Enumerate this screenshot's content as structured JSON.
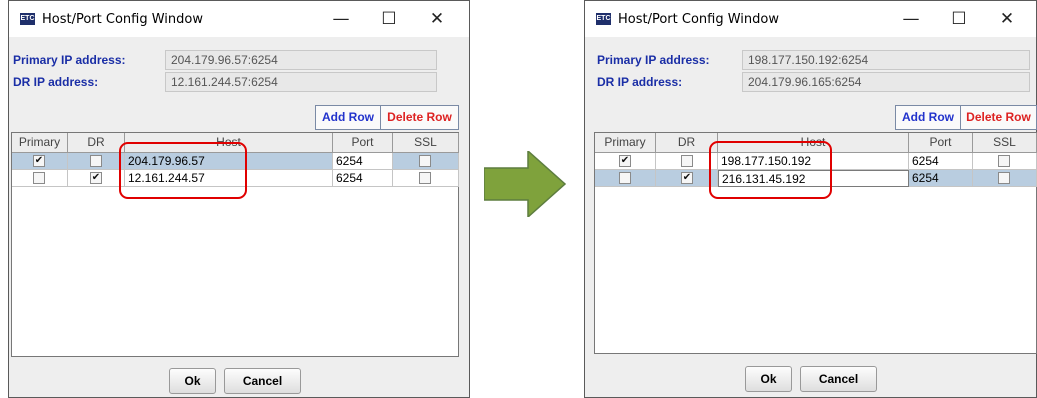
{
  "windows": [
    {
      "title": "Host/Port Config Window",
      "icon_text": "ETC",
      "controls": {
        "minimize": "—",
        "maximize": "☐",
        "close": "✕"
      },
      "primary_label": "Primary IP address:",
      "primary_value": "204.179.96.57:6254",
      "dr_label": "DR IP address:",
      "dr_value": "12.161.244.57:6254",
      "add_row": "Add Row",
      "delete_row": "Delete Row",
      "columns": [
        "Primary",
        "DR",
        "Host",
        "Port",
        "SSL"
      ],
      "rows": [
        {
          "primary": true,
          "dr": false,
          "host": "204.179.96.57",
          "port": "6254",
          "ssl": false,
          "selected": true
        },
        {
          "primary": false,
          "dr": true,
          "host": "12.161.244.57",
          "port": "6254",
          "ssl": false,
          "selected": false
        }
      ],
      "ok": "Ok",
      "cancel": "Cancel"
    },
    {
      "title": "Host/Port Config Window",
      "icon_text": "ETC",
      "controls": {
        "minimize": "—",
        "maximize": "☐",
        "close": "✕"
      },
      "primary_label": "Primary IP address:",
      "primary_value": "198.177.150.192:6254",
      "dr_label": "DR IP address:",
      "dr_value": "204.179.96.165:6254",
      "add_row": "Add Row",
      "delete_row": "Delete Row",
      "columns": [
        "Primary",
        "DR",
        "Host",
        "Port",
        "SSL"
      ],
      "rows": [
        {
          "primary": true,
          "dr": false,
          "host": "198.177.150.192",
          "port": "6254",
          "ssl": false,
          "selected": false
        },
        {
          "primary": false,
          "dr": true,
          "host": "216.131.45.192",
          "port": "6254",
          "ssl": false,
          "selected": true
        }
      ],
      "ok": "Ok",
      "cancel": "Cancel"
    }
  ],
  "colors": {
    "label": "#1a2ea6",
    "add": "#2233cc",
    "delete": "#dd2222",
    "highlight": "#e00000",
    "arrow": "#7fa23c"
  }
}
